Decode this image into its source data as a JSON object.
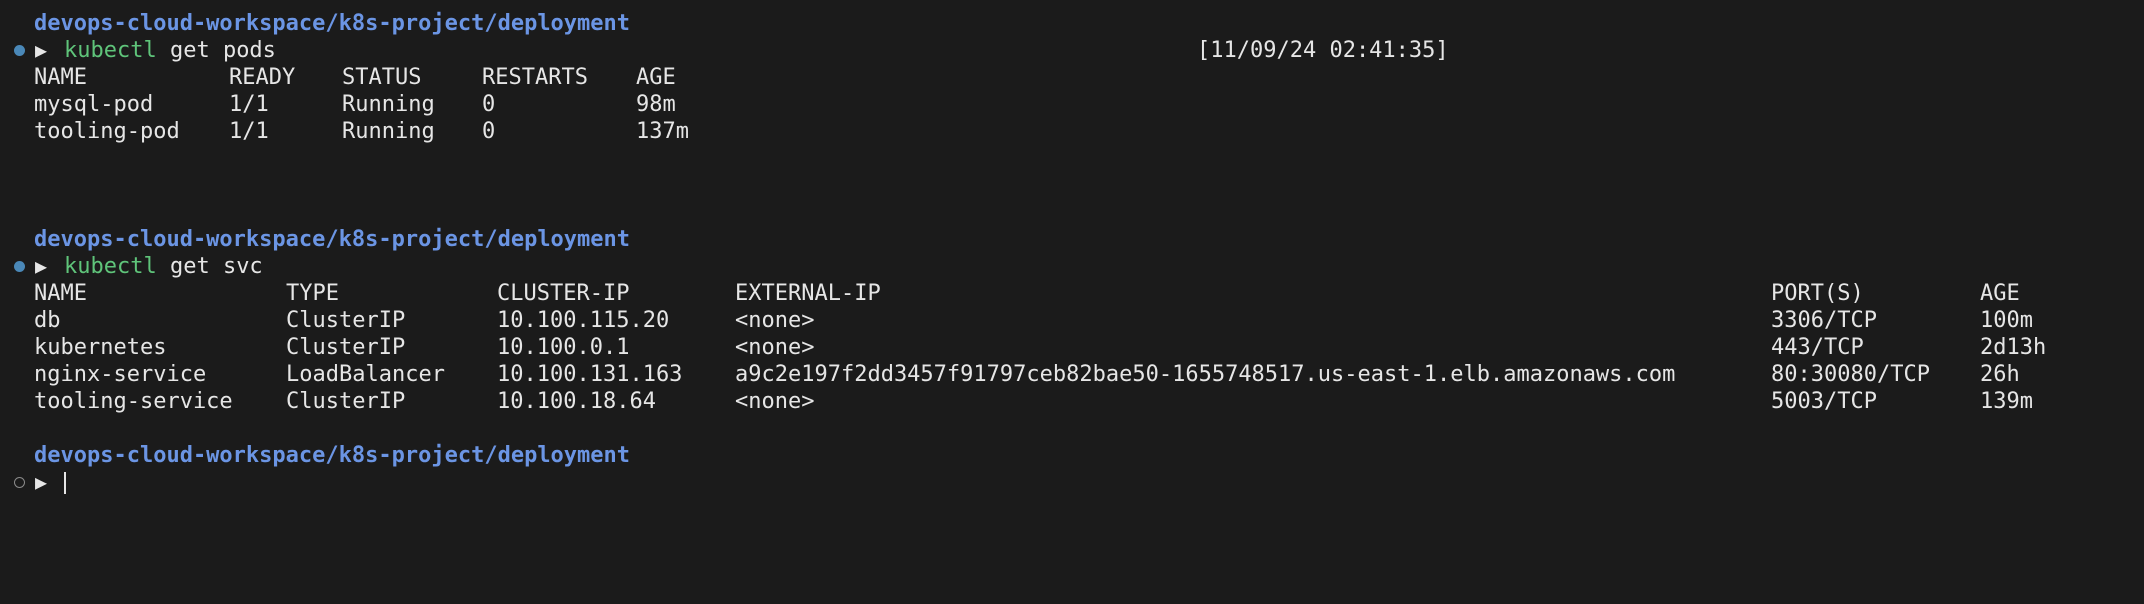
{
  "colors": {
    "background": "#1b1b1b",
    "path": "#6b95e4",
    "command": "#5fc47a",
    "text": "#e6e6e6",
    "dot": "#4a88b8"
  },
  "prompt_path": "devops-cloud-workspace/k8s-project/deployment",
  "prompt_symbol": "▶",
  "block1": {
    "command_name": "kubectl",
    "command_args": " get pods",
    "timestamp": "[11/09/24 02:41:35]",
    "headers": [
      "NAME",
      "READY",
      "STATUS",
      "RESTARTS",
      "AGE"
    ],
    "rows": [
      [
        "mysql-pod",
        "1/1",
        "Running",
        "0",
        "98m"
      ],
      [
        "tooling-pod",
        "1/1",
        "Running",
        "0",
        "137m"
      ]
    ]
  },
  "block2": {
    "command_name": "kubectl",
    "command_args": " get svc",
    "headers": [
      "NAME",
      "TYPE",
      "CLUSTER-IP",
      "EXTERNAL-IP",
      "PORT(S)",
      "AGE"
    ],
    "rows": [
      [
        "db",
        "ClusterIP",
        "10.100.115.20",
        "<none>",
        "3306/TCP",
        "100m"
      ],
      [
        "kubernetes",
        "ClusterIP",
        "10.100.0.1",
        "<none>",
        "443/TCP",
        "2d13h"
      ],
      [
        "nginx-service",
        "LoadBalancer",
        "10.100.131.163",
        "a9c2e197f2dd3457f91797ceb82bae50-1655748517.us-east-1.elb.amazonaws.com",
        "80:30080/TCP",
        "26h"
      ],
      [
        "tooling-service",
        "ClusterIP",
        "10.100.18.64",
        "<none>",
        "5003/TCP",
        "139m"
      ]
    ]
  }
}
